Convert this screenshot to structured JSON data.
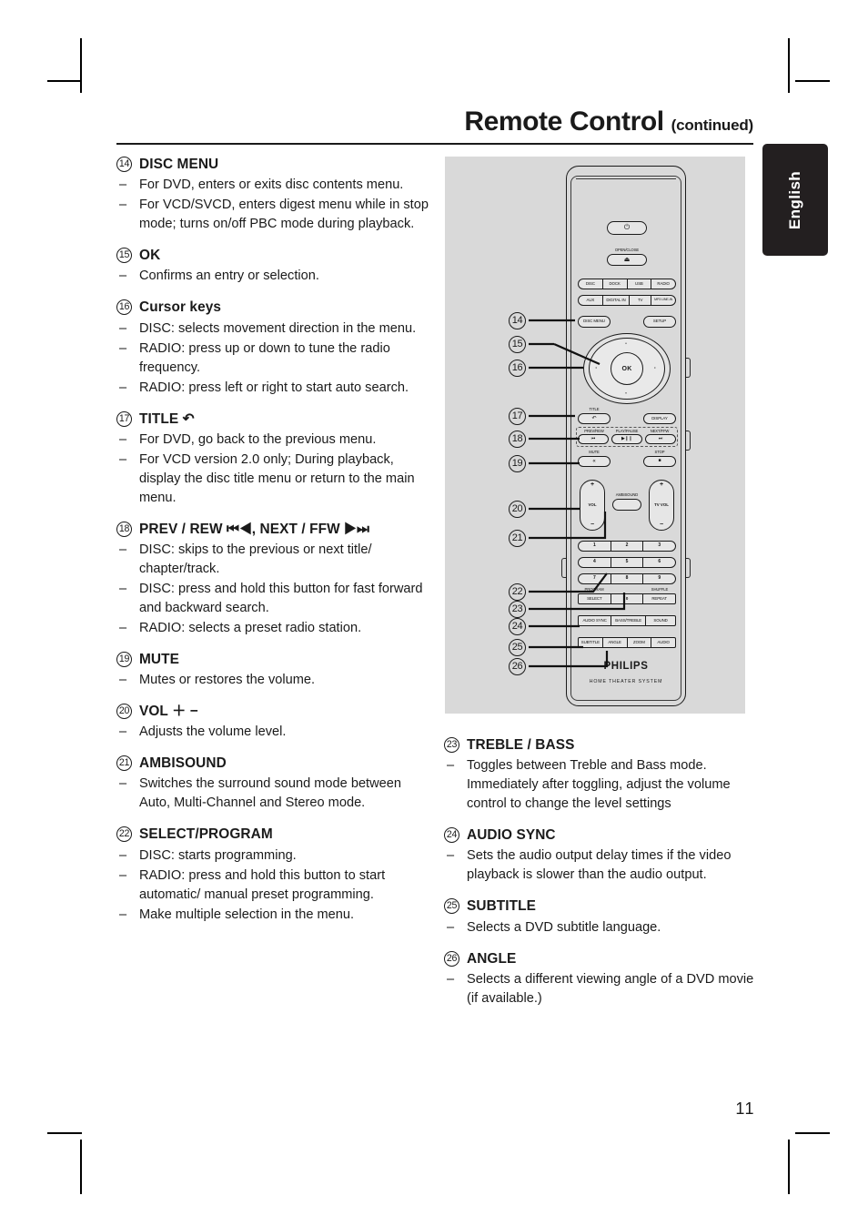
{
  "header": {
    "title": "Remote Control",
    "continued": "(continued)"
  },
  "lang_tab": {
    "label": "English"
  },
  "page_number": "11",
  "left_column": [
    {
      "num": "14",
      "title": "DISC MENU",
      "bullets": [
        "For DVD, enters or exits disc contents menu.",
        "For VCD/SVCD, enters digest menu while in stop mode; turns on/off PBC mode during playback."
      ]
    },
    {
      "num": "15",
      "title": "OK",
      "bullets": [
        "Confirms an entry or selection."
      ]
    },
    {
      "num": "16",
      "title": "Cursor keys",
      "bullets": [
        "DISC: selects movement direction in the menu.",
        "RADIO: press up or down to tune the radio frequency.",
        "RADIO: press left or right to start auto search."
      ]
    },
    {
      "num": "17",
      "title": "TITLE ↶",
      "bullets": [
        "For DVD, go back to the previous menu.",
        "For VCD version 2.0 only; During playback, display the disc title menu or return to the main menu."
      ]
    },
    {
      "num": "18",
      "title": "PREV / REW ⏮◀, NEXT / FFW ▶⏭",
      "bullets": [
        "DISC: skips to the previous or next title/ chapter/track.",
        "DISC: press and hold this button for fast forward and backward search.",
        "RADIO: selects a preset radio station."
      ]
    },
    {
      "num": "19",
      "title": "MUTE",
      "bullets": [
        "Mutes or restores the volume."
      ]
    },
    {
      "num": "20",
      "title": "VOL ＋ −",
      "bullets": [
        "Adjusts the volume level."
      ]
    },
    {
      "num": "21",
      "title": "AMBISOUND",
      "bullets": [
        "Switches the surround sound mode between Auto, Multi-Channel and Stereo mode."
      ]
    },
    {
      "num": "22",
      "title": "SELECT/PROGRAM",
      "bullets": [
        "DISC: starts programming.",
        "RADIO: press and hold this button to start automatic/ manual preset programming.",
        "Make multiple selection in the menu."
      ]
    }
  ],
  "right_column": [
    {
      "num": "23",
      "title": "TREBLE / BASS",
      "bullets": [
        "Toggles between Treble and Bass mode. Immediately after toggling, adjust the volume control to change the level settings"
      ]
    },
    {
      "num": "24",
      "title": "AUDIO SYNC",
      "bullets": [
        "Sets the audio output delay times if the video playback is slower than the audio output."
      ]
    },
    {
      "num": "25",
      "title": "SUBTITLE",
      "bullets": [
        "Selects a DVD subtitle language."
      ]
    },
    {
      "num": "26",
      "title": "ANGLE",
      "bullets": [
        "Selects a different viewing angle of a DVD movie (if available.)"
      ]
    }
  ],
  "figure": {
    "callout_numbers": [
      "14",
      "15",
      "16",
      "17",
      "18",
      "19",
      "20",
      "21",
      "22",
      "23",
      "24",
      "25",
      "26"
    ],
    "remote": {
      "power_icon": "⏻",
      "open_close_label": "OPEN/CLOSE",
      "open_close_icon": "⏏",
      "source_row_1": [
        "DISC",
        "DOCK",
        "USB",
        "RADIO"
      ],
      "source_row_2": [
        "AUX",
        "DIGITAL IN",
        "TV",
        "MP3 LINE-IN"
      ],
      "disc_menu": "DISC MENU",
      "setup": "SETUP",
      "ok": "OK",
      "title_label": "TITLE",
      "title_icon": "↶",
      "display": "DISPLAY",
      "transport_labels": [
        "PREV/REW",
        "PLAY/PAUSE",
        "NEXT/FFW"
      ],
      "transport_icons": [
        "⏮",
        "▶❙❙",
        "⏭"
      ],
      "mute_label": "MUTE",
      "mute_icon": "«",
      "stop_label": "STOP",
      "stop_icon": "■",
      "vol_name": "VOL",
      "tv_vol_name": "TV VOL",
      "plus": "+",
      "minus": "−",
      "ambisound": "AMBISOUND",
      "keypad": [
        "1",
        "2",
        "3",
        "4",
        "5",
        "6",
        "7",
        "8",
        "9"
      ],
      "program_label": "PROGRAM",
      "shuffle_label": "SHUFFLE",
      "select": "SELECT",
      "zero": "0",
      "repeat": "REPEAT",
      "fn_row_1": [
        "AUDIO SYNC",
        "BASS/TREBLE",
        "SOUND"
      ],
      "fn_row_2": [
        "SUBTITLE",
        "ANGLE",
        "ZOOM",
        "AUDIO"
      ],
      "brand": "PHILIPS",
      "brand_sub": "HOME THEATER SYSTEM"
    }
  }
}
